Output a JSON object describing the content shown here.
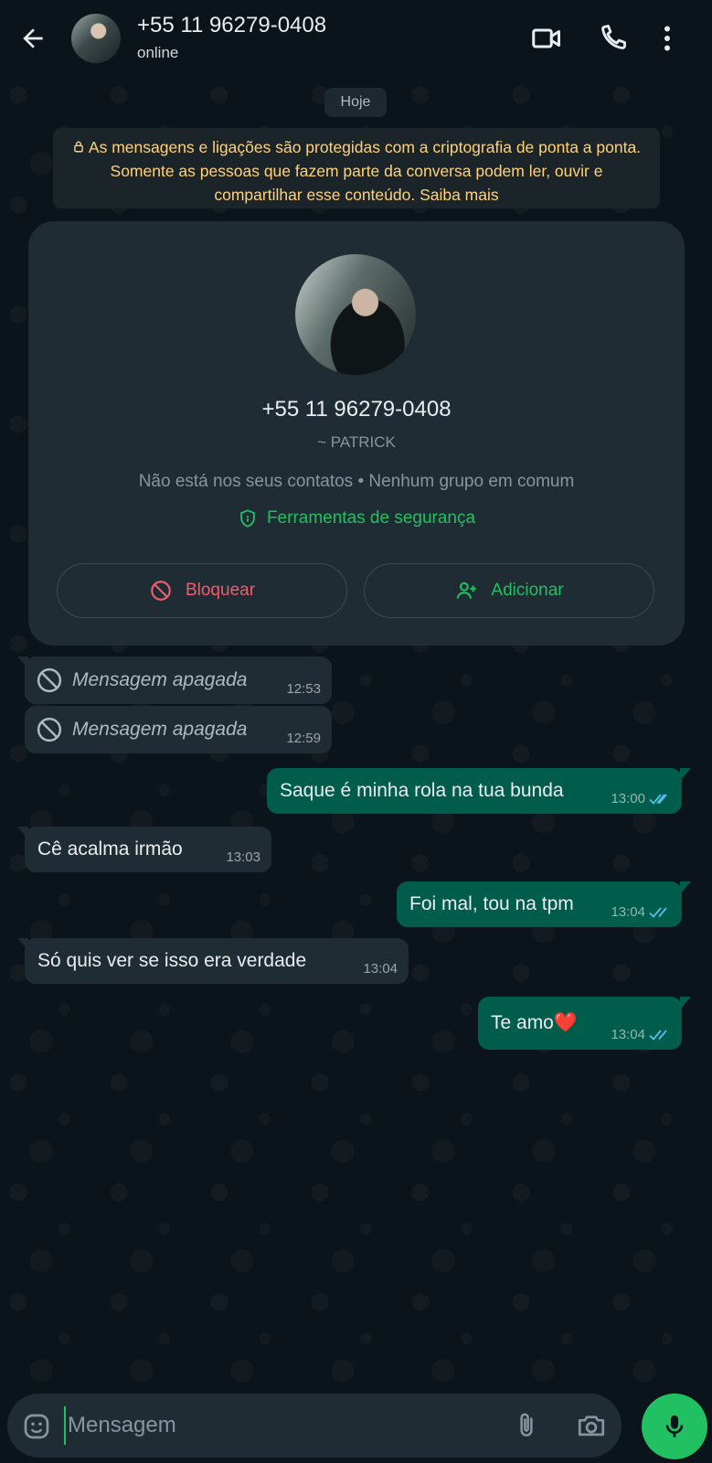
{
  "header": {
    "title": "+55 11 96279-0408",
    "status": "online"
  },
  "date_chip": "Hoje",
  "encryption_notice": "As mensagens e ligações são protegidas com a criptografia de ponta a ponta. Somente as pessoas que fazem parte da conversa podem ler, ouvir e compartilhar esse conteúdo. Saiba mais",
  "contact_card": {
    "number": "+55 11 96279-0408",
    "name": "~ PATRICK",
    "info": "Não está nos seus contatos • Nenhum grupo em comum",
    "security_link": "Ferramentas de segurança",
    "block_label": "Bloquear",
    "add_label": "Adicionar"
  },
  "messages": [
    {
      "direction": "in",
      "deleted": true,
      "text": "Mensagem apagada",
      "time": "12:53"
    },
    {
      "direction": "in",
      "deleted": true,
      "text": "Mensagem apagada",
      "time": "12:59"
    },
    {
      "direction": "out",
      "text": "Saque é minha rola na tua bunda",
      "time": "13:00",
      "status": "read"
    },
    {
      "direction": "in",
      "text": "Cê acalma irmão",
      "time": "13:03"
    },
    {
      "direction": "out",
      "text": "Foi mal, tou na tpm",
      "time": "13:04",
      "status": "read"
    },
    {
      "direction": "in",
      "text": "Só quis ver se isso era verdade",
      "time": "13:04"
    },
    {
      "direction": "out",
      "text": "Te amo❤️",
      "time": "13:04",
      "status": "read"
    }
  ],
  "input": {
    "placeholder": "Mensagem"
  },
  "colors": {
    "background": "#0b141a",
    "incoming_bubble": "#1f2c33",
    "outgoing_bubble": "#005c4b",
    "accent_green": "#21c063",
    "danger_red": "#f15c6d",
    "notice_yellow": "#ffd279",
    "read_ticks": "#53bdeb"
  },
  "icons": [
    "back-arrow-icon",
    "video-call-icon",
    "phone-icon",
    "more-vert-icon",
    "lock-icon",
    "shield-icon",
    "block-icon",
    "add-person-icon",
    "deleted-icon",
    "double-check-icon",
    "emoji-icon",
    "attach-icon",
    "camera-icon",
    "mic-icon"
  ]
}
